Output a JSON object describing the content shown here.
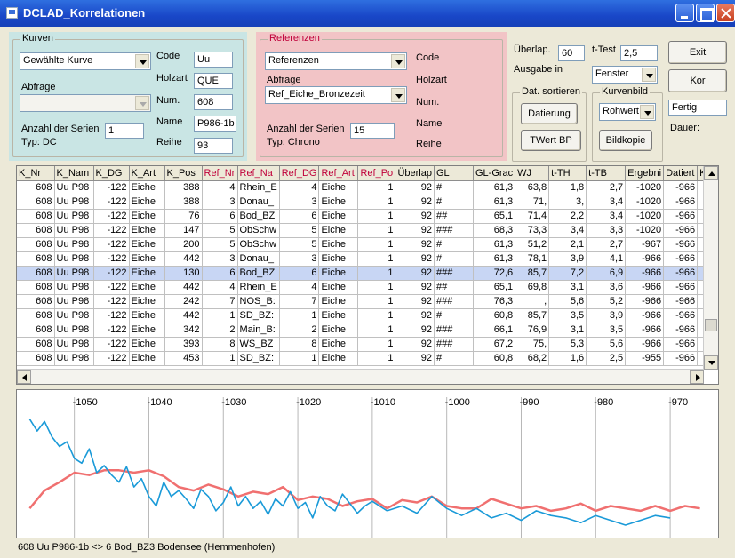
{
  "window": {
    "title": "DCLAD_Korrelationen"
  },
  "kurven": {
    "legend": "Kurven",
    "combo": "Gewählte Kurve",
    "abfrage_label": "Abfrage",
    "abfrage_value": "",
    "anzahl_label": "Anzahl der Serien",
    "anzahl_value": "1",
    "typ": "Typ: DC",
    "code_label": "Code",
    "code_value": "Uu",
    "holzart_label": "Holzart",
    "holzart_value": "QUE",
    "num_label": "Num.",
    "num_value": "608",
    "name_label": "Name",
    "name_value": "P986-1b",
    "reihe_label": "Reihe",
    "reihe_value": "93"
  },
  "referenzen": {
    "legend": "Referenzen",
    "combo": "Referenzen",
    "abfrage_label": "Abfrage",
    "abfrage_value": "Ref_Eiche_Bronzezeit",
    "anzahl_label": "Anzahl der Serien",
    "anzahl_value": "15",
    "typ": "Typ: Chrono",
    "code_label": "Code",
    "holzart_label": "Holzart",
    "num_label": "Num.",
    "name_label": "Name",
    "reihe_label": "Reihe"
  },
  "options": {
    "ueberlap_label": "Überlap.",
    "ueberlap_value": "60",
    "ttest_label": "t-Test",
    "ttest_value": "2,5",
    "ausgabe_label": "Ausgabe in",
    "ausgabe_value": "Fenster",
    "sort_legend": "Dat. sortieren",
    "datierung_button": "Datierung",
    "twert_button": "TWert BP",
    "kurvenbild_legend": "Kurvenbild",
    "kurvenbild_value": "Rohwert",
    "bildkopie_button": "Bildkopie",
    "exit_button": "Exit",
    "kor_button": "Kor",
    "status_value": "Fertig",
    "dauer_label": "Dauer:"
  },
  "table": {
    "columns": [
      "K_Nr",
      "K_Nam",
      "K_DG",
      "K_Art",
      "K_Pos",
      "Ref_Nr",
      "Ref_Na",
      "Ref_DG",
      "Ref_Art",
      "Ref_Po",
      "Überlap",
      "GL",
      "GL-Grac",
      "WJ",
      "t-TH",
      "t-TB",
      "Ergebni",
      "Datiert",
      "K_"
    ],
    "ref_columns": [
      5,
      6,
      7,
      8,
      9
    ],
    "rows": [
      [
        "608",
        "Uu P98",
        "-122",
        "Eiche",
        "388",
        "4",
        "Rhein_E",
        "4",
        "Eiche",
        "1",
        "92",
        "#",
        "61,3",
        "63,8",
        "1,8",
        "2,7",
        "-1020",
        "-966",
        ""
      ],
      [
        "608",
        "Uu P98",
        "-122",
        "Eiche",
        "388",
        "3",
        "Donau_",
        "3",
        "Eiche",
        "1",
        "92",
        "#",
        "61,3",
        "71,",
        "3,",
        "3,4",
        "-1020",
        "-966",
        ""
      ],
      [
        "608",
        "Uu P98",
        "-122",
        "Eiche",
        "76",
        "6",
        "Bod_BZ",
        "6",
        "Eiche",
        "1",
        "92",
        "##",
        "65,1",
        "71,4",
        "2,2",
        "3,4",
        "-1020",
        "-966",
        ""
      ],
      [
        "608",
        "Uu P98",
        "-122",
        "Eiche",
        "147",
        "5",
        "ObSchw",
        "5",
        "Eiche",
        "1",
        "92",
        "###",
        "68,3",
        "73,3",
        "3,4",
        "3,3",
        "-1020",
        "-966",
        ""
      ],
      [
        "608",
        "Uu P98",
        "-122",
        "Eiche",
        "200",
        "5",
        "ObSchw",
        "5",
        "Eiche",
        "1",
        "92",
        "#",
        "61,3",
        "51,2",
        "2,1",
        "2,7",
        "-967",
        "-966",
        ""
      ],
      [
        "608",
        "Uu P98",
        "-122",
        "Eiche",
        "442",
        "3",
        "Donau_",
        "3",
        "Eiche",
        "1",
        "92",
        "#",
        "61,3",
        "78,1",
        "3,9",
        "4,1",
        "-966",
        "-966",
        ""
      ],
      [
        "608",
        "Uu P98",
        "-122",
        "Eiche",
        "130",
        "6",
        "Bod_BZ",
        "6",
        "Eiche",
        "1",
        "92",
        "###",
        "72,6",
        "85,7",
        "7,2",
        "6,9",
        "-966",
        "-966",
        ""
      ],
      [
        "608",
        "Uu P98",
        "-122",
        "Eiche",
        "442",
        "4",
        "Rhein_E",
        "4",
        "Eiche",
        "1",
        "92",
        "##",
        "65,1",
        "69,8",
        "3,1",
        "3,6",
        "-966",
        "-966",
        ""
      ],
      [
        "608",
        "Uu P98",
        "-122",
        "Eiche",
        "242",
        "7",
        "NOS_B:",
        "7",
        "Eiche",
        "1",
        "92",
        "###",
        "76,3",
        ",",
        "5,6",
        "5,2",
        "-966",
        "-966",
        ""
      ],
      [
        "608",
        "Uu P98",
        "-122",
        "Eiche",
        "442",
        "1",
        "SD_BZ:",
        "1",
        "Eiche",
        "1",
        "92",
        "#",
        "60,8",
        "85,7",
        "3,5",
        "3,9",
        "-966",
        "-966",
        ""
      ],
      [
        "608",
        "Uu P98",
        "-122",
        "Eiche",
        "342",
        "2",
        "Main_B:",
        "2",
        "Eiche",
        "1",
        "92",
        "###",
        "66,1",
        "76,9",
        "3,1",
        "3,5",
        "-966",
        "-966",
        ""
      ],
      [
        "608",
        "Uu P98",
        "-122",
        "Eiche",
        "393",
        "8",
        "WS_BZ",
        "8",
        "Eiche",
        "1",
        "92",
        "###",
        "67,2",
        "75,",
        "5,3",
        "5,6",
        "-966",
        "-966",
        ""
      ],
      [
        "608",
        "Uu P98",
        "-122",
        "Eiche",
        "453",
        "1",
        "SD_BZ:",
        "1",
        "Eiche",
        "1",
        "92",
        "#",
        "60,8",
        "68,2",
        "1,6",
        "2,5",
        "-955",
        "-966",
        ""
      ]
    ],
    "selected_row": 6
  },
  "chart_data": {
    "type": "line",
    "x_ticks": [
      "-1050",
      "-1040",
      "-1030",
      "-1020",
      "-1010",
      "-1000",
      "-990",
      "-980",
      "-970"
    ],
    "xlim": [
      -1057,
      -965
    ],
    "grid": "vertical lines every 10 years",
    "series": [
      {
        "color": "#f07070",
        "x": [
          -1056,
          -1054,
          -1052,
          -1050,
          -1048,
          -1046,
          -1044,
          -1042,
          -1040,
          -1038,
          -1036,
          -1034,
          -1032,
          -1030,
          -1028,
          -1026,
          -1024,
          -1022,
          -1020,
          -1018,
          -1016,
          -1014,
          -1012,
          -1010,
          -1008,
          -1006,
          -1004,
          -1002,
          -1000,
          -998,
          -996,
          -994,
          -992,
          -990,
          -988,
          -986,
          -984,
          -982,
          -980,
          -978,
          -976,
          -974,
          -972,
          -970,
          -968,
          -966
        ],
        "y": [
          0.2,
          0.35,
          0.42,
          0.5,
          0.48,
          0.52,
          0.52,
          0.5,
          0.52,
          0.47,
          0.38,
          0.35,
          0.4,
          0.36,
          0.3,
          0.34,
          0.32,
          0.38,
          0.27,
          0.3,
          0.28,
          0.22,
          0.26,
          0.28,
          0.2,
          0.27,
          0.25,
          0.3,
          0.22,
          0.2,
          0.2,
          0.28,
          0.24,
          0.2,
          0.22,
          0.18,
          0.2,
          0.24,
          0.18,
          0.22,
          0.2,
          0.18,
          0.22,
          0.18,
          0.22,
          0.2
        ]
      },
      {
        "color": "#1a9ad8",
        "x": [
          -1056,
          -1055,
          -1054,
          -1053,
          -1052,
          -1051,
          -1050,
          -1049,
          -1048,
          -1047,
          -1046,
          -1045,
          -1044,
          -1043,
          -1042,
          -1041,
          -1040,
          -1039,
          -1038,
          -1037,
          -1036,
          -1035,
          -1034,
          -1033,
          -1032,
          -1031,
          -1030,
          -1029,
          -1028,
          -1027,
          -1026,
          -1025,
          -1024,
          -1023,
          -1022,
          -1021,
          -1020,
          -1019,
          -1018,
          -1017,
          -1016,
          -1015,
          -1014,
          -1013,
          -1012,
          -1011,
          -1010,
          -1008,
          -1006,
          -1004,
          -1002,
          -1000,
          -998,
          -996,
          -994,
          -992,
          -990,
          -988,
          -986,
          -984,
          -982,
          -980,
          -978,
          -976,
          -974,
          -972,
          -970
        ],
        "y": [
          0.95,
          0.85,
          0.93,
          0.8,
          0.72,
          0.76,
          0.62,
          0.58,
          0.7,
          0.5,
          0.56,
          0.48,
          0.42,
          0.55,
          0.38,
          0.45,
          0.3,
          0.22,
          0.42,
          0.3,
          0.35,
          0.28,
          0.2,
          0.36,
          0.3,
          0.18,
          0.25,
          0.38,
          0.22,
          0.3,
          0.2,
          0.26,
          0.15,
          0.28,
          0.22,
          0.34,
          0.2,
          0.25,
          0.12,
          0.3,
          0.22,
          0.18,
          0.32,
          0.24,
          0.16,
          0.22,
          0.26,
          0.18,
          0.22,
          0.16,
          0.3,
          0.2,
          0.14,
          0.2,
          0.12,
          0.16,
          0.1,
          0.18,
          0.14,
          0.12,
          0.08,
          0.14,
          0.1,
          0.06,
          0.1,
          0.14,
          0.12
        ]
      }
    ]
  },
  "status": {
    "text": "608 Uu P986-1b <> 6 Bod_BZ3 Bodensee (Hemmenhofen)"
  }
}
